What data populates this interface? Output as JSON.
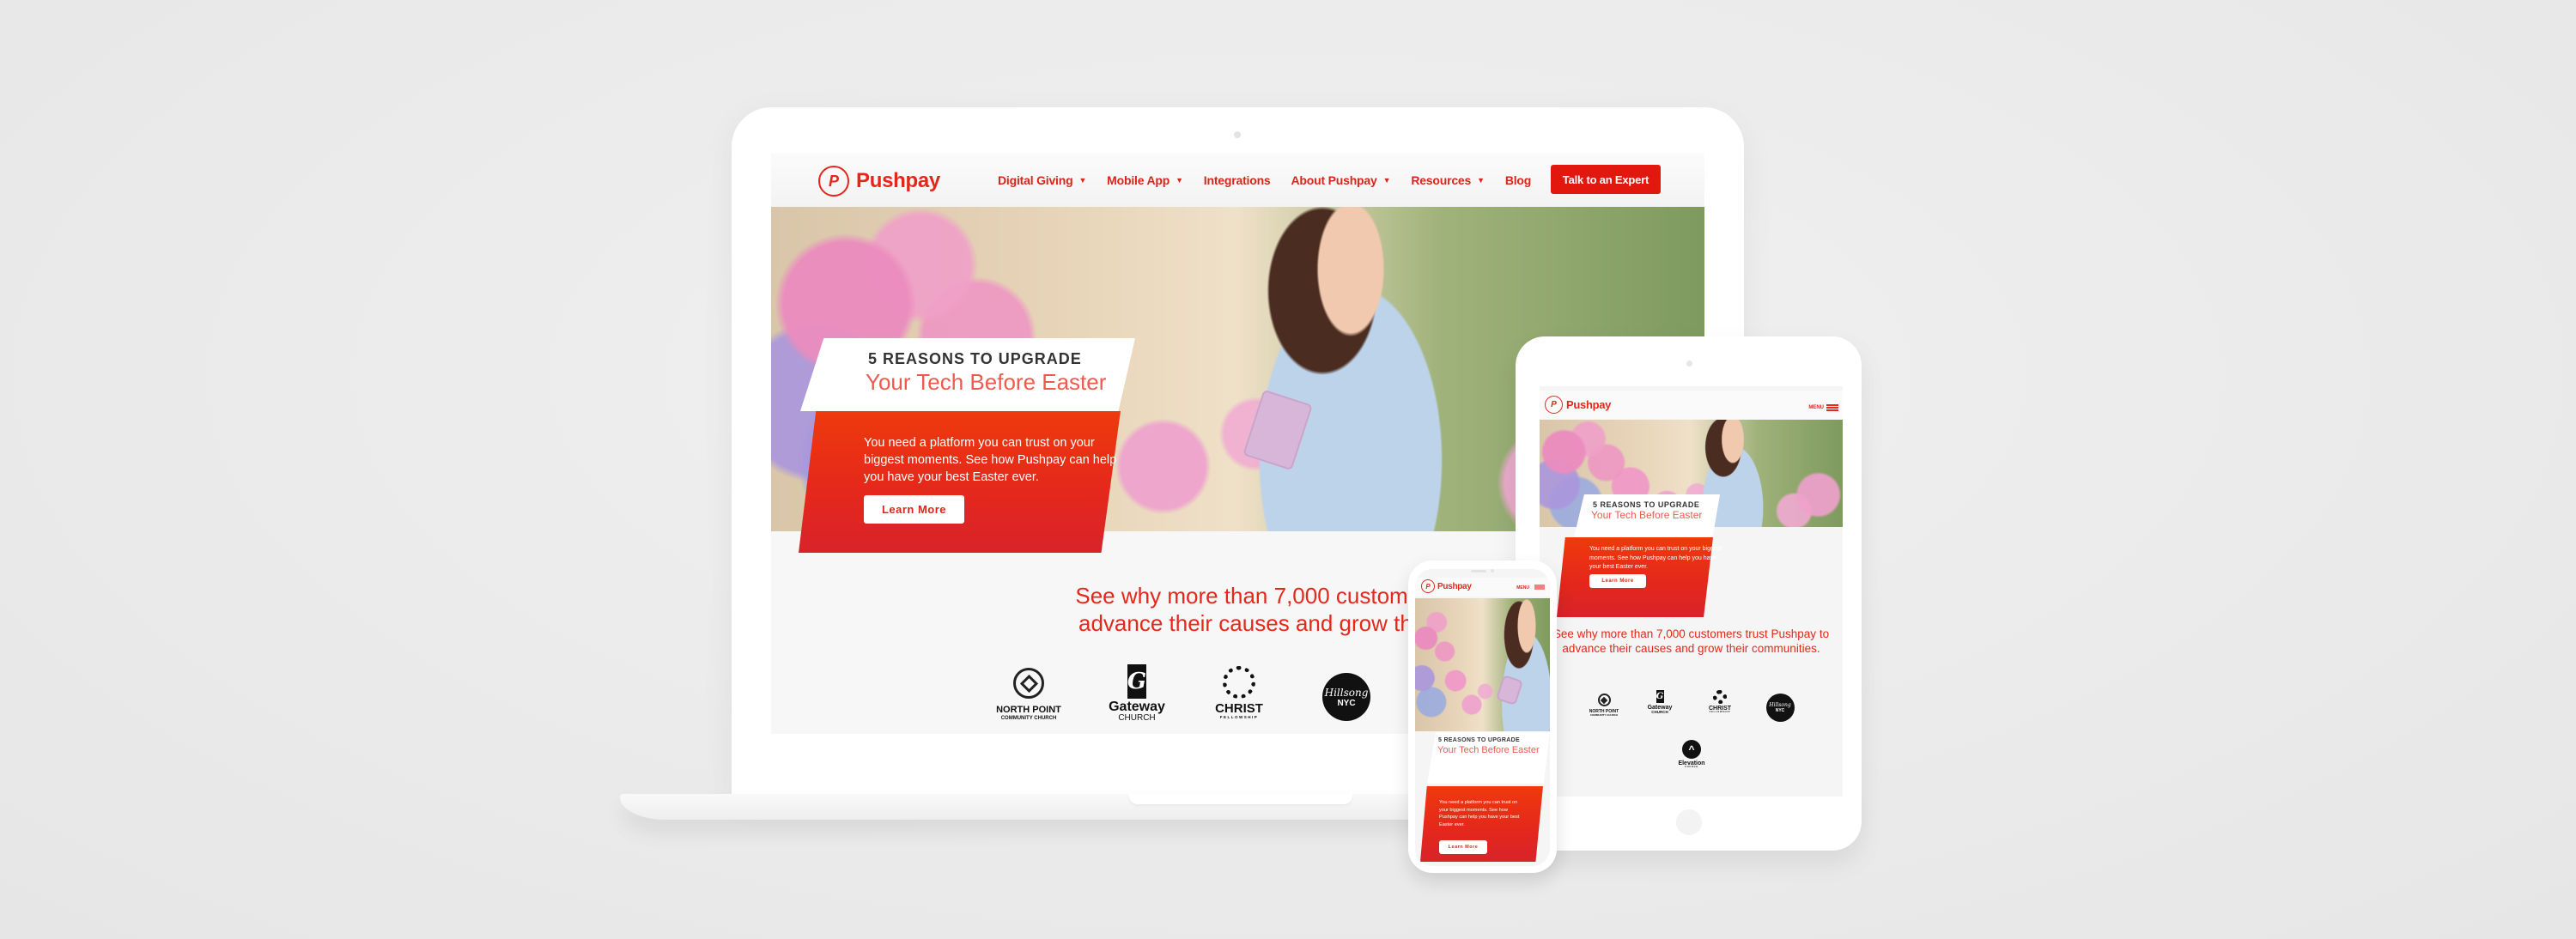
{
  "brand": {
    "name": "Pushpay",
    "mark": "P",
    "accent": "#e4261c",
    "cta_color": "#e2180f"
  },
  "desktop": {
    "nav": [
      {
        "label": "Digital Giving",
        "has_dropdown": true
      },
      {
        "label": "Mobile App",
        "has_dropdown": true
      },
      {
        "label": "Integrations",
        "has_dropdown": false
      },
      {
        "label": "About Pushpay",
        "has_dropdown": true
      },
      {
        "label": "Resources",
        "has_dropdown": true
      },
      {
        "label": "Blog",
        "has_dropdown": false
      }
    ],
    "caret_glyph": "▼",
    "cta_label": "Talk to an Expert",
    "tagline": "See why more than 7,000 customers trust Pushpay to advance their causes and grow their communities.",
    "tagline_line1_visible": "See why more than 7,000 customers trust",
    "tagline_line2_visible": "advance their causes and grow their com"
  },
  "promo": {
    "kicker": "5 REASONS TO UPGRADE",
    "title": "Your Tech Before Easter",
    "body": "You need a platform you can trust on your biggest moments. See how Pushpay can help you have your best Easter ever.",
    "button_label": "Learn More"
  },
  "mobile": {
    "menu_label": "MENU"
  },
  "tablet": {
    "tagline": "See why more than 7,000 customers trust Pushpay to advance their causes and grow their communities.",
    "tagline_visible": "See why more than 7,000 customers trust\nushpay to advance their causes and grow their\ncommunities."
  },
  "churches": [
    {
      "id": "north-point",
      "name": "NORTH POINT",
      "sub": "COMMUNITY CHURCH"
    },
    {
      "id": "gateway",
      "name": "Gateway",
      "sub": "CHURCH",
      "icon_glyph": "G"
    },
    {
      "id": "christ-fellowship",
      "name": "CHRIST",
      "sub": "FELLOWSHIP"
    },
    {
      "id": "hillsong",
      "name": "Hillsong",
      "sub": "NYC"
    },
    {
      "id": "elevation",
      "name": "Elevation",
      "sub": "CHURCH",
      "icon_glyph": "^"
    }
  ]
}
